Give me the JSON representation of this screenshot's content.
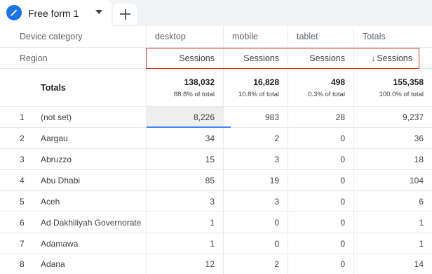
{
  "tab": {
    "label": "Free form 1"
  },
  "headers": {
    "dimension1": "Device category",
    "dimension2": "Region",
    "columns": [
      "desktop",
      "mobile",
      "tablet",
      "Totals"
    ],
    "metric": "Sessions",
    "sort_arrow": "↓"
  },
  "totals": {
    "label": "Totals",
    "values": [
      {
        "value": "138,032",
        "pct": "88.8% of total"
      },
      {
        "value": "16,828",
        "pct": "10.8% of total"
      },
      {
        "value": "498",
        "pct": "0.3% of total"
      },
      {
        "value": "155,358",
        "pct": "100.0% of total"
      }
    ]
  },
  "rows": [
    {
      "n": "1",
      "region": "(not set)",
      "desktop": "8,226",
      "mobile": "983",
      "tablet": "28",
      "total": "9,237"
    },
    {
      "n": "2",
      "region": "Aargau",
      "desktop": "34",
      "mobile": "2",
      "tablet": "0",
      "total": "36"
    },
    {
      "n": "3",
      "region": "Abruzzo",
      "desktop": "15",
      "mobile": "3",
      "tablet": "0",
      "total": "18"
    },
    {
      "n": "4",
      "region": "Abu Dhabi",
      "desktop": "85",
      "mobile": "19",
      "tablet": "0",
      "total": "104"
    },
    {
      "n": "5",
      "region": "Aceh",
      "desktop": "3",
      "mobile": "3",
      "tablet": "0",
      "total": "6"
    },
    {
      "n": "6",
      "region": "Ad Dakhiliyah Governorate",
      "desktop": "1",
      "mobile": "0",
      "tablet": "0",
      "total": "1"
    },
    {
      "n": "7",
      "region": "Adamawa",
      "desktop": "1",
      "mobile": "0",
      "tablet": "0",
      "total": "1"
    },
    {
      "n": "8",
      "region": "Adana",
      "desktop": "12",
      "mobile": "2",
      "tablet": "0",
      "total": "14"
    }
  ],
  "colors": {
    "accent": "#1a73e8",
    "highlight": "#d93025",
    "selected_underline": "#4285f4"
  }
}
